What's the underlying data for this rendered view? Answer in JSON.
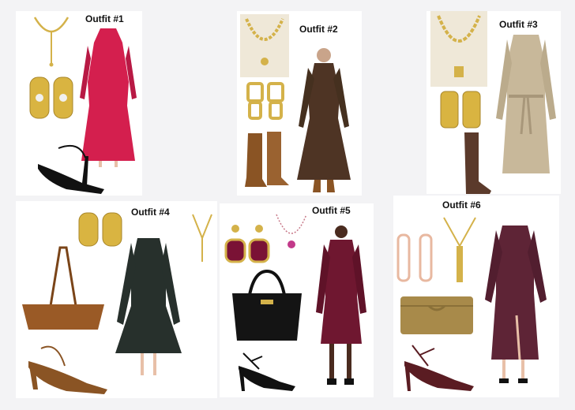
{
  "board": {
    "outfits": [
      {
        "label": "Outfit #1"
      },
      {
        "label": "Outfit #2"
      },
      {
        "label": "Outfit #3"
      },
      {
        "label": "Outfit #4"
      },
      {
        "label": "Outfit #5"
      },
      {
        "label": "Outfit #6"
      }
    ]
  },
  "colors": {
    "background": "#f3f3f5",
    "gold": "#d4b24a",
    "outfit1_dress": "#d41f4e",
    "outfit2_dress": "#4e3424",
    "outfit2_boots": "#8a5424",
    "outfit3_dress": "#c8b89a",
    "outfit3_boots": "#5b3a2b",
    "outfit4_dress": "#27302c",
    "outfit4_bag": "#9a5a26",
    "outfit5_dress": "#6f1730",
    "outfit5_gem": "#7a1235",
    "outfit6_dress": "#5e2436",
    "outfit6_bag": "#a88a4a",
    "outfit6_shoes": "#5a1c22"
  }
}
